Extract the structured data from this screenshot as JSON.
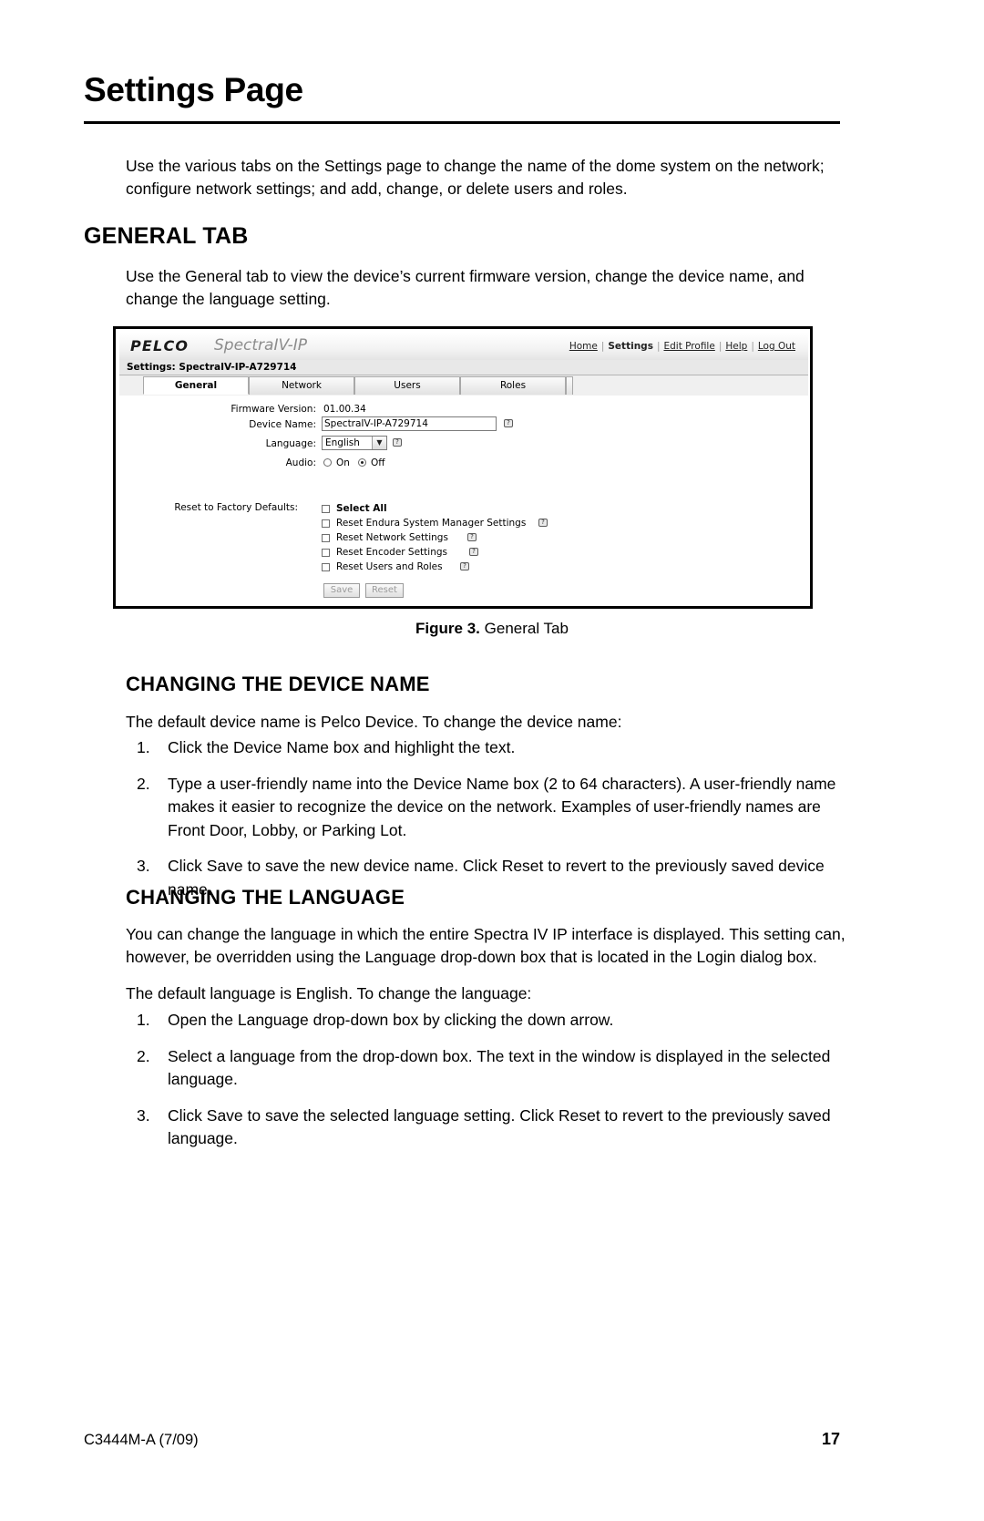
{
  "document": {
    "title": "Settings Page",
    "intro": "Use the various tabs on the Settings page to change the name of the dome system on the network; configure network settings; and add, change, or delete users and roles.",
    "sections": {
      "general_tab": {
        "heading": "GENERAL TAB",
        "paragraph": "Use the General tab to view the device’s current firmware version, change the device name, and change the language setting."
      },
      "changing_device_name": {
        "heading": "CHANGING THE DEVICE NAME",
        "paragraph": "The default device name is Pelco Device. To change the device name:",
        "steps": [
          "Click the Device Name box and highlight the text.",
          "Type a user-friendly name into the Device Name box (2 to 64 characters). A user-friendly name makes it easier to recognize the device on the network. Examples of user-friendly names are Front Door, Lobby, or Parking Lot.",
          "Click Save to save the new device name. Click Reset to revert to the previously saved device name."
        ]
      },
      "changing_language": {
        "heading": "CHANGING THE LANGUAGE",
        "paragraph1": "You can change the language in which the entire Spectra IV IP interface is displayed. This setting can, however, be overridden using the Language drop-down box that is located in the Login dialog box.",
        "paragraph2": "The default language is English. To change the language:",
        "steps": [
          "Open the Language drop-down box by clicking the down arrow.",
          "Select a language from the drop-down box. The text in the window is displayed in the selected language.",
          "Click Save to save the selected language setting. Click Reset to revert to the previously saved language."
        ]
      }
    },
    "figure": {
      "caption_label": "Figure 3.",
      "caption_text": "General Tab"
    },
    "footer": {
      "left": "C3444M-A (7/09)",
      "page_number": "17"
    }
  },
  "screenshot": {
    "brand": "PELCO",
    "product": "SpectraIV-IP",
    "nav": [
      "Home",
      "Settings",
      "Edit Profile",
      "Help",
      "Log Out"
    ],
    "nav_current": "Settings",
    "settings_bar": "Settings: SpectraIV-IP-A729714",
    "tabs": [
      "General",
      "Network",
      "Users",
      "Roles"
    ],
    "active_tab": "General",
    "fields": {
      "firmware_label": "Firmware Version:",
      "firmware_value": "01.00.34",
      "device_name_label": "Device Name:",
      "device_name_value": "SpectraIV-IP-A729714",
      "language_label": "Language:",
      "language_value": "English",
      "audio_label": "Audio:",
      "audio_on": "On",
      "audio_off": "Off",
      "audio_selected": "Off"
    },
    "reset_section": {
      "label": "Reset to Factory Defaults:",
      "items": [
        "Select All",
        "Reset Endura System Manager Settings",
        "Reset Network Settings",
        "Reset Encoder Settings",
        "Reset Users and Roles"
      ]
    },
    "buttons": {
      "save": "Save",
      "reset": "Reset"
    }
  }
}
